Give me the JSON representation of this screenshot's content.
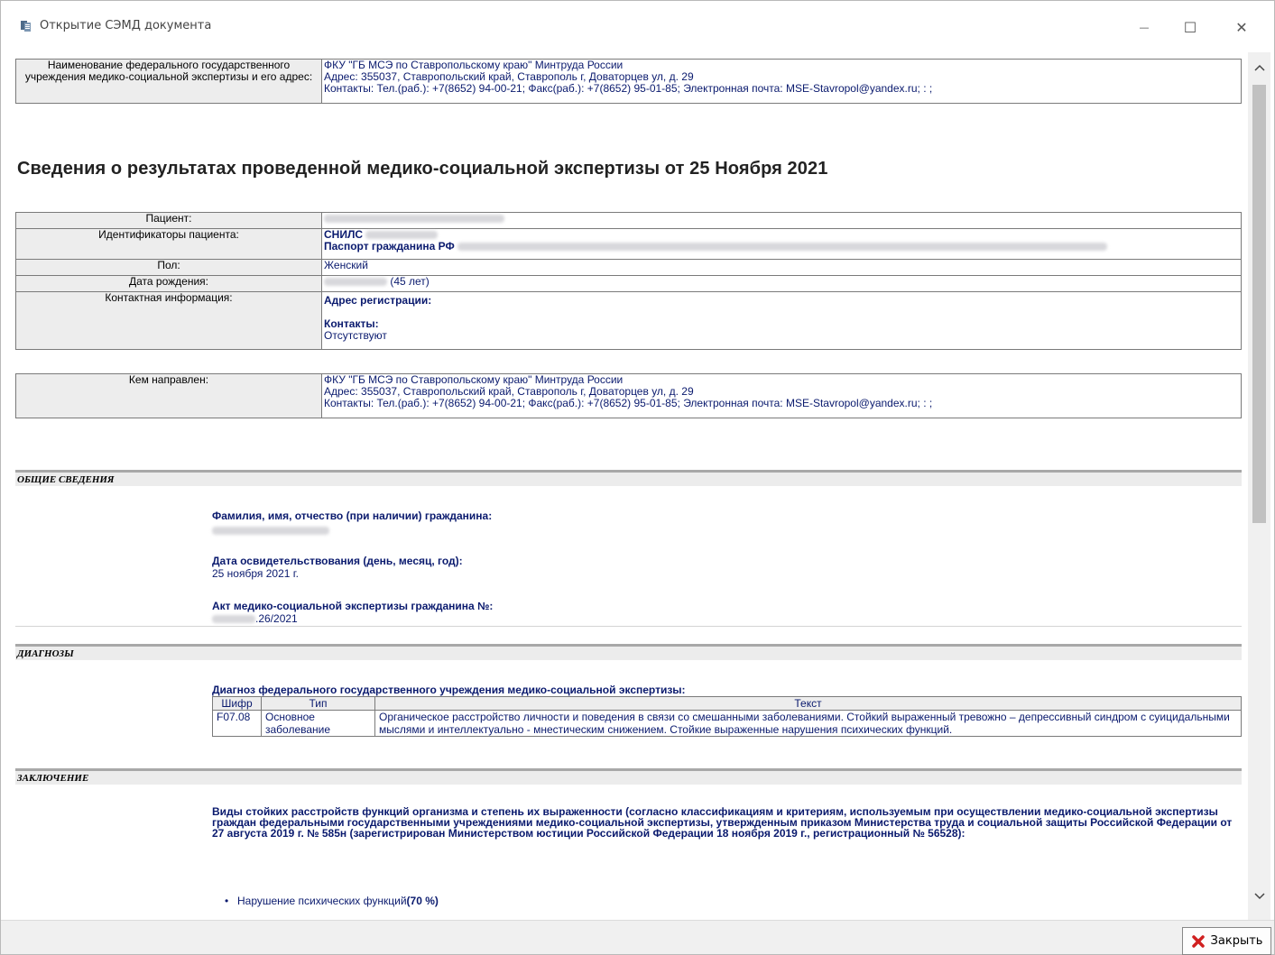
{
  "window": {
    "title": "Открытие СЭМД документа",
    "minimize_glyph": "—",
    "maximize_glyph": "☐",
    "close_glyph": "✕"
  },
  "org_header": {
    "label": "Наименование федерального государственного учреждения медико-социальной экспертизы и его адрес:",
    "name": "ФКУ \"ГБ МСЭ по Ставропольскому краю\" Минтруда России",
    "address": "Адрес: 355037, Ставропольский край, Ставрополь г, Доваторцев ул, д. 29",
    "contacts": "Контакты: Тел.(раб.): +7(8652) 94-00-21; Факс(раб.): +7(8652) 95-01-85; Электронная почта: MSE-Stavropol@yandex.ru; : ;"
  },
  "main_title": "Сведения о результатах проведенной медико-социальной экспертизы от 25 Ноября 2021",
  "patient": {
    "patient_label": "Пациент:",
    "ids_label": "Идентификаторы пациента:",
    "snils_label": "СНИЛС",
    "passport_label": "Паспорт гражданина РФ",
    "sex_label": "Пол:",
    "sex_value": "Женский",
    "dob_label": "Дата рождения:",
    "age_value": "(45 лет)",
    "contact_label": "Контактная информация:",
    "reg_address_label": "Адрес регистрации:",
    "contacts_label": "Контакты:",
    "contacts_value": "Отсутствуют"
  },
  "referrer": {
    "label": "Кем направлен:",
    "name": "ФКУ \"ГБ МСЭ по Ставропольскому краю\" Минтруда России",
    "address": "Адрес: 355037, Ставропольский край, Ставрополь г, Доваторцев ул, д. 29",
    "contacts": "Контакты: Тел.(раб.): +7(8652) 94-00-21; Факс(раб.): +7(8652) 95-01-85; Электронная почта: MSE-Stavropol@yandex.ru; : ;"
  },
  "general": {
    "section_title": "ОБЩИЕ СВЕДЕНИЯ",
    "fio_label": "Фамилия, имя, отчество (при наличии) гражданина:",
    "exam_date_label": "Дата освидетельствования (день, месяц, год):",
    "exam_date_value": "25 ноября 2021 г.",
    "act_label": "Акт медико-социальной экспертизы гражданина №:",
    "act_value_suffix": ".26/2021"
  },
  "diagnoses": {
    "section_title": "ДИАГНОЗЫ",
    "caption": "Диагноз федерального государственного учреждения медико-социальной экспертизы:",
    "headers": [
      "Шифр",
      "Тип",
      "Текст"
    ],
    "rows": [
      {
        "code": "F07.08",
        "type": "Основное заболевание",
        "text": "Органическое расстройство личности и поведения в связи со смешанными заболеваниями. Стойкий выраженный тревожно – депрессивный синдром с суицидальными мыслями и интеллектуально - мнестическим снижением. Стойкие выраженные нарушения психических функций."
      }
    ]
  },
  "conclusion": {
    "section_title": "ЗАКЛЮЧЕНИЕ",
    "paragraph": "Виды стойких расстройств функций организма и степень их выраженности (согласно классификациям и критериям, используемым при осуществлении медико-социальной экспертизы граждан федеральными государственными учреждениями медико-социальной экспертизы, утвержденным приказом Министерства труда и социальной защиты Российской Федерации от 27 августа 2019 г. № 585н (зарегистрирован Министерством юстиции Российской Федерации 18 ноября 2019 г., регистрационный № 56528):",
    "items": [
      {
        "label": "Нарушение психических функций",
        "value": "(70 %)"
      }
    ]
  },
  "footer": {
    "close_label": "Закрыть"
  },
  "icons": {
    "app": "document-app-icon",
    "close": "red-x-icon"
  },
  "colors": {
    "text_blue": "#0a1a6e",
    "label_bg": "#ededed",
    "close_red": "#d02020"
  }
}
